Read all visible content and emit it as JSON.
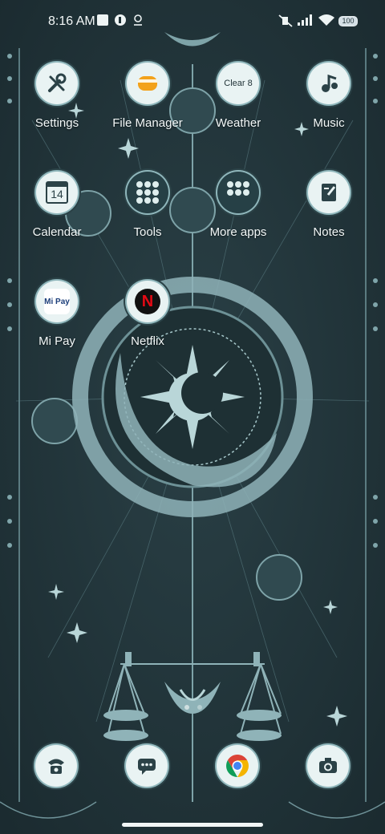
{
  "status_bar": {
    "time": "8:16 AM",
    "battery_level": "100",
    "left_icons": [
      "notification-square-icon",
      "app-notification-icon",
      "location-icon"
    ],
    "right_icons": [
      "mute-icon",
      "signal-icon",
      "signal-icon",
      "wifi-icon",
      "battery-icon"
    ]
  },
  "apps": [
    {
      "label": "Settings",
      "icon": "wrench-screwdriver-icon"
    },
    {
      "label": "File Manager",
      "icon": "folder-icon"
    },
    {
      "label": "Weather",
      "icon": "cloud-icon",
      "badge": "Clear 8"
    },
    {
      "label": "Music",
      "icon": "music-note-icon"
    },
    {
      "label": "Calendar",
      "icon": "calendar-icon",
      "badge": "14"
    },
    {
      "label": "Tools",
      "icon": "folder-grid-icon"
    },
    {
      "label": "More apps",
      "icon": "folder-grid-icon"
    },
    {
      "label": "Notes",
      "icon": "notepad-icon"
    },
    {
      "label": "Mi Pay",
      "icon": "mi-pay-icon",
      "badge": "Mi Pay"
    },
    {
      "label": "Netflix",
      "icon": "netflix-icon",
      "badge": "N"
    }
  ],
  "dock": [
    {
      "name": "phone",
      "icon": "phone-icon"
    },
    {
      "name": "messages",
      "icon": "message-icon"
    },
    {
      "name": "chrome",
      "icon": "chrome-icon"
    },
    {
      "name": "camera",
      "icon": "camera-icon"
    }
  ],
  "page_indicator": {
    "pages": 2,
    "current": 1
  },
  "colors": {
    "background": "#1f3136",
    "icon_ring": "#8fb6bb",
    "accent": "#a9cfd1",
    "netflix_red": "#e50914"
  }
}
